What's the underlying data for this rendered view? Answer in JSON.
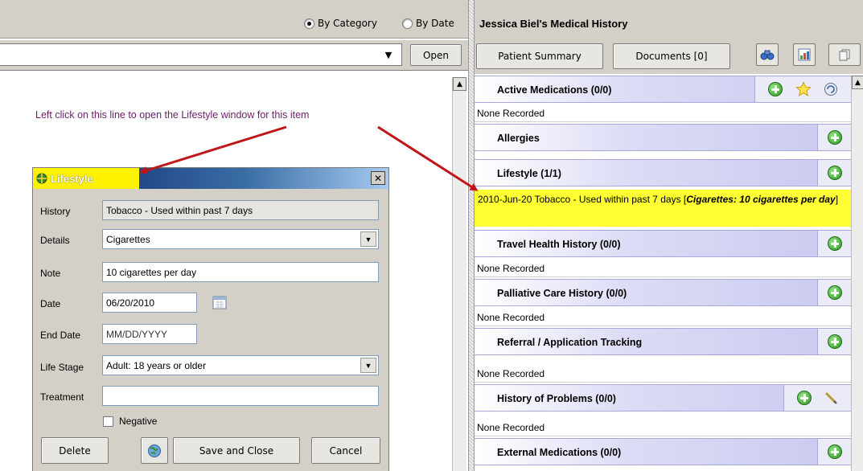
{
  "view_toggle": {
    "by_category": "By Category",
    "by_date": "By Date"
  },
  "left_toolbar": {
    "open_label": "Open"
  },
  "instruction_text": "Left click on this line to open the Lifestyle window for this item",
  "lifestyle_dialog": {
    "title": "Lifestyle",
    "history_label": "History",
    "history_value": "Tobacco - Used within past 7 days",
    "details_label": "Details",
    "details_value": "Cigarettes",
    "note_label": "Note",
    "note_value": "10 cigarettes per day",
    "date_label": "Date",
    "date_value": "06/20/2010",
    "end_date_label": "End Date",
    "end_date_placeholder": "MM/DD/YYYY",
    "life_stage_label": "Life Stage",
    "life_stage_value": "Adult: 18 years or older",
    "treatment_label": "Treatment",
    "treatment_value": "",
    "negative_label": "Negative",
    "delete_label": "Delete",
    "save_close_label": "Save and Close",
    "cancel_label": "Cancel"
  },
  "medical_history": {
    "title": "Jessica Biel's Medical History",
    "patient_summary_label": "Patient Summary",
    "documents_label": "Documents [0]",
    "sections": {
      "active_medications": {
        "name": "Active Medications (0/0)",
        "row": "None Recorded"
      },
      "allergies": {
        "name": "Allergies"
      },
      "lifestyle": {
        "name": "Lifestyle (1/1)",
        "row_prefix": "2010-Jun-20   Tobacco - Used within past 7 days [",
        "row_emphasis": "Cigarettes: 10 cigarettes per day",
        "row_suffix": "]"
      },
      "travel_health": {
        "name": "Travel Health History (0/0)",
        "row": "None Recorded"
      },
      "palliative_care": {
        "name": "Palliative Care History (0/0)",
        "row": "None Recorded"
      },
      "referral_tracking": {
        "name": "Referral / Application Tracking",
        "row": "None Recorded"
      },
      "history_of_problems": {
        "name": "History of Problems (0/0)",
        "row": "None Recorded"
      },
      "external_medications": {
        "name": "External Medications (0/0)"
      }
    }
  },
  "colors": {
    "highlight_yellow": "#ffff33",
    "arrow_red": "#c0161a",
    "instruction_purple": "#6b1f6b",
    "section_header": "#c9c9ef",
    "title_bar": "#0a246a"
  }
}
